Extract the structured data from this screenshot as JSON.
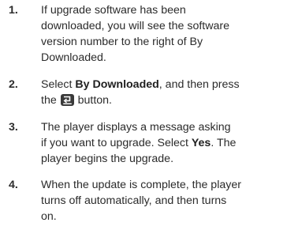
{
  "steps": [
    {
      "number": "1.",
      "lines": [
        "If upgrade software has been",
        "downloaded, you will see the software",
        "version number to the right of By",
        "Downloaded."
      ]
    },
    {
      "number": "2.",
      "line1_pre": "Select ",
      "line1_bold": "By Downloaded",
      "line1_post": ", and then press",
      "line2_pre": "the ",
      "button_icon": "enter-button-icon",
      "line2_post": " button."
    },
    {
      "number": "3.",
      "line1": "The player displays a message asking",
      "line2_pre": "if you want to upgrade. Select ",
      "line2_bold": "Yes",
      "line2_post": ". The",
      "line3": "player begins the upgrade."
    },
    {
      "number": "4.",
      "lines": [
        "When the update is complete, the player",
        "turns off automatically, and then turns",
        "on."
      ]
    }
  ],
  "colors": {
    "text": "#2b2b2b",
    "icon": "#3a3a3a"
  }
}
